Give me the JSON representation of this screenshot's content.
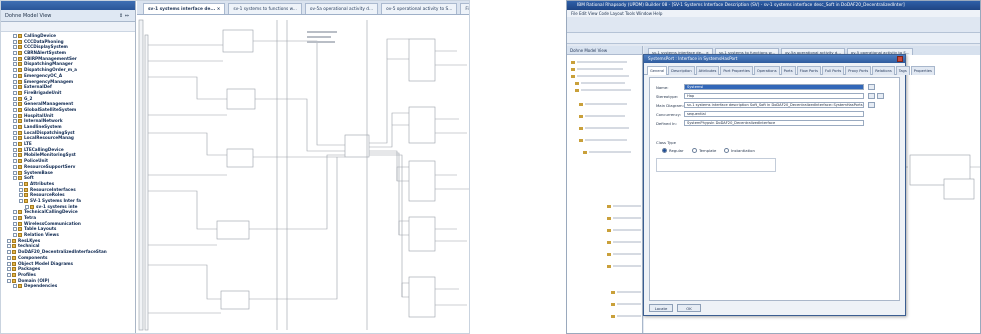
{
  "left": {
    "tree_tab": "Dohne Model View",
    "tree_tab_controls": "⇕ ⇔",
    "tree_items": [
      {
        "label": "CallingDevice",
        "indent": 1
      },
      {
        "label": "CCCDataPhoning",
        "indent": 1
      },
      {
        "label": "CCCDisplaySystem",
        "indent": 1
      },
      {
        "label": "CBRNAlertSystem",
        "indent": 1
      },
      {
        "label": "CBIRPManagementSer",
        "indent": 1
      },
      {
        "label": "DispatchingManager",
        "indent": 1
      },
      {
        "label": "DispatchingOrder_m_a",
        "indent": 1
      },
      {
        "label": "EmergencyOC_A",
        "indent": 1
      },
      {
        "label": "EmergencyManagem",
        "indent": 1
      },
      {
        "label": "ExternalDef",
        "indent": 1
      },
      {
        "label": "FireBrigadeUnit",
        "indent": 1
      },
      {
        "label": "G_2",
        "indent": 1
      },
      {
        "label": "GeneralManagement",
        "indent": 1
      },
      {
        "label": "GlobalSatelliteSystem",
        "indent": 1
      },
      {
        "label": "HospitalUnit",
        "indent": 1
      },
      {
        "label": "InternalNetwork",
        "indent": 1
      },
      {
        "label": "LandlineSystem",
        "indent": 1
      },
      {
        "label": "LocalDispatchingSyst",
        "indent": 1
      },
      {
        "label": "LocalResourceManag",
        "indent": 1
      },
      {
        "label": "LTE",
        "indent": 1
      },
      {
        "label": "LTECallingDevice",
        "indent": 1
      },
      {
        "label": "MobileMonitoringSyst",
        "indent": 1
      },
      {
        "label": "PoliceUnit",
        "indent": 1
      },
      {
        "label": "ResourceSupportServ",
        "indent": 1
      },
      {
        "label": "SystemBase",
        "indent": 1
      },
      {
        "label": "Soft",
        "indent": 1
      },
      {
        "label": "Attributes",
        "indent": 2
      },
      {
        "label": "ResourceInterfaces",
        "indent": 2
      },
      {
        "label": "ResourceRoles",
        "indent": 2
      },
      {
        "label": "SV-1 Systems Inter fa",
        "indent": 2
      },
      {
        "label": "sv-1 systems inte",
        "indent": 3
      },
      {
        "label": "TechnicalCallingDevice",
        "indent": 1
      },
      {
        "label": "Tetra",
        "indent": 1
      },
      {
        "label": "WirelessCommunication",
        "indent": 1
      },
      {
        "label": "Table Layouts",
        "indent": 1
      },
      {
        "label": "Relation Views",
        "indent": 1
      },
      {
        "label": "ResLKyes",
        "indent": 0
      },
      {
        "label": "technical",
        "indent": 0
      },
      {
        "label": "DoDAF20_DecentralizedInterfaceStan",
        "indent": 0
      },
      {
        "label": "Components",
        "indent": 0
      },
      {
        "label": "Object Model Diagrams",
        "indent": 0
      },
      {
        "label": "Packages",
        "indent": 0
      },
      {
        "label": "Profiles",
        "indent": 0
      },
      {
        "label": "Domain (OIP)",
        "indent": 0
      },
      {
        "label": "Dependencies",
        "indent": 1
      }
    ],
    "tabs": [
      {
        "label": "sv-1 systems interface de... ×",
        "active": true
      },
      {
        "label": "sv-1 systems to functions w...",
        "active": false
      },
      {
        "label": "ov-5a operational activity d...",
        "active": false
      },
      {
        "label": "ov-5 operational activity to S...",
        "active": false
      },
      {
        "label": "Fixn01",
        "active": false
      }
    ]
  },
  "right": {
    "title": "IBM Rational Rhapsody (UPDM) Builder 08 - [SV-1 Systems Interface Description (SV) - sv-1 systems interface desc_Soft in DoDAF20_DecentralizedInter]",
    "menu": "File  Edit  View  Code  Layout  Tools  Window  Help",
    "left_header": "Dohne Model View",
    "tabs": [
      "sv-1 systems interface de... ×",
      "sv-1 systems to functions w...",
      "ov-5a operational activity d...",
      "ov-5 operational activity to S..."
    ],
    "dialog": {
      "title": "SystemsPort : Interface in SystemsHasPort",
      "tabs": [
        "General",
        "Description",
        "Attributes",
        "Port Properties",
        "Operations",
        "Ports",
        "Flow Ports",
        "Full Ports",
        "Proxy Ports",
        "Relations",
        "Tags",
        "Properties"
      ],
      "active_tab": "General",
      "fields": [
        {
          "label": "Name:",
          "value": "SystemsI"
        },
        {
          "label": "Stereotype:",
          "value": "Hap"
        },
        {
          "label": "Main Diagram:",
          "value": "sv-1 systems interface description Soft_Soft in DoDAF20_DecentralizedInterface::SystemHasPorts"
        },
        {
          "label": "Concurrency:",
          "value": "sequential"
        },
        {
          "label": "Defined In:",
          "value": "SystemPhypsIn DoDAF20_DecentralizedInterface"
        }
      ],
      "class_type_label": "Class Type",
      "radios": [
        "Regular",
        "Template",
        "Instantiation"
      ],
      "selected_radio": "Regular",
      "buttons": [
        "Locate",
        "OK"
      ]
    }
  }
}
